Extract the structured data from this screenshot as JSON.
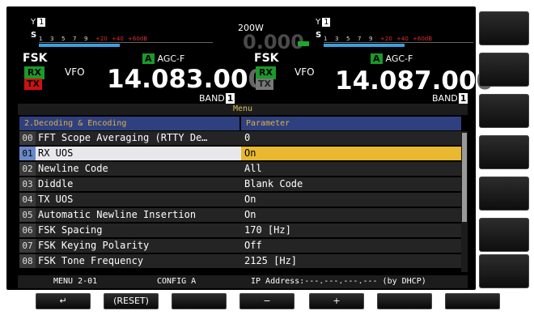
{
  "meter_left": {
    "antenna": "Y",
    "antenna_num": "1",
    "s_label": "S",
    "ticks": [
      "1",
      "3",
      "5",
      "7",
      "9",
      "+20",
      "+40",
      "+60dB"
    ]
  },
  "meter_right": {
    "antenna": "Y",
    "antenna_num": "1",
    "s_label": "S",
    "ticks": [
      "1",
      "3",
      "5",
      "7",
      "9",
      "+20",
      "+40",
      "+60dB"
    ]
  },
  "power": "200W",
  "power_meter_value": "0.000",
  "vfo_left": {
    "mode": "FSK",
    "rx": "RX",
    "tx": "TX",
    "vfo": "VFO",
    "agc_tag": "A",
    "agc": "AGC-F",
    "freq_main": "14.083.00",
    "freq_dim": "0",
    "band": "BAND",
    "band_num": "1"
  },
  "vfo_right": {
    "mode": "FSK",
    "rx": "RX",
    "tx": "TX",
    "vfo": "VFO",
    "agc_tag": "A",
    "agc": "AGC-F",
    "freq_main": "14.087.00",
    "freq_dim": "0",
    "band": "BAND",
    "band_num": "1"
  },
  "menu": {
    "title": "Menu",
    "group_header": "2.Decoding & Encoding",
    "param_header": "Parameter",
    "rows": [
      {
        "num": "00",
        "name": "FFT Scope Averaging (RTTY De…",
        "value": "0"
      },
      {
        "num": "01",
        "name": "RX UOS",
        "value": "On"
      },
      {
        "num": "02",
        "name": "Newline Code",
        "value": "All"
      },
      {
        "num": "03",
        "name": "Diddle",
        "value": "Blank Code"
      },
      {
        "num": "04",
        "name": "TX UOS",
        "value": "On"
      },
      {
        "num": "05",
        "name": "Automatic Newline Insertion",
        "value": "On"
      },
      {
        "num": "06",
        "name": "FSK Spacing",
        "value": "170 [Hz]"
      },
      {
        "num": "07",
        "name": "FSK Keying Polarity",
        "value": "Off"
      },
      {
        "num": "08",
        "name": "FSK Tone Frequency",
        "value": "2125 [Hz]"
      }
    ],
    "selected_index": 1,
    "scroll_position": 0.0
  },
  "status": {
    "menu_id": "MENU 2-01",
    "config": "CONFIG A",
    "ip": "IP Address:---.---.---.--- (by DHCP)"
  },
  "bottom_keys": {
    "back": "↵",
    "reset": "(RESET)",
    "blank1": "",
    "minus": "−",
    "plus": "+",
    "blank2": "",
    "blank3": ""
  },
  "colors": {
    "rx_green": "#1a9a2a",
    "tx_red": "#d01010",
    "header_blue": "#2e4080",
    "selected_value": "#e8b830",
    "meter_blue": "#3aa0e0"
  }
}
